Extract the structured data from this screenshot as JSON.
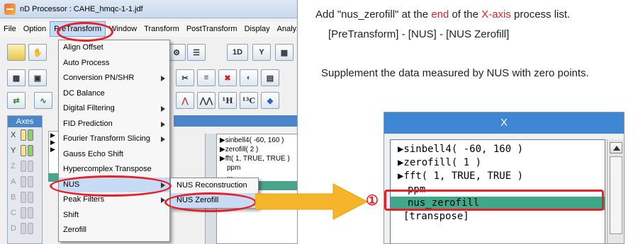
{
  "window": {
    "title": "nD Processor : CAHE_hmqc-1-1.jdf"
  },
  "menubar": [
    "File",
    "Option",
    "PreTransform",
    "Window",
    "Transform",
    "PostTransform",
    "Display",
    "Analyz"
  ],
  "toolbar": {
    "btn_1d": "1D",
    "btn_y": "Y",
    "btn_1h": "¹H",
    "btn_13c": "¹³C",
    "btn_spectrum": "⋀⋀"
  },
  "axes_panel": {
    "title": "Axes",
    "rows": [
      "X",
      "Y",
      "Z",
      "A",
      "B",
      "C",
      "D"
    ]
  },
  "pretransform_menu": {
    "items": [
      {
        "label": "Align Offset",
        "submenu": false
      },
      {
        "label": "Auto Process",
        "submenu": false
      },
      {
        "label": "Conversion PN/SHR",
        "submenu": true
      },
      {
        "label": "DC Balance",
        "submenu": false
      },
      {
        "label": "Digital Filtering",
        "submenu": true
      },
      {
        "label": "FID Prediction",
        "submenu": true
      },
      {
        "label": "Fourier Transform Slicing",
        "submenu": true
      },
      {
        "label": "Gauss Echo Shift",
        "submenu": false
      },
      {
        "label": "Hypercomplex Transpose",
        "submenu": false
      },
      {
        "label": "NUS",
        "submenu": true
      },
      {
        "label": "Peak Filters",
        "submenu": true
      },
      {
        "label": "Shift",
        "submenu": false
      },
      {
        "label": "Zerofill",
        "submenu": false
      }
    ]
  },
  "nus_submenu": {
    "items": [
      "NUS Reconstruction",
      "NUS Zerofill"
    ]
  },
  "process_list_small": [
    "▶sinbell4( -60, 160 )",
    "▶zerofill( 2 )",
    "▶fft( 1, TRUE, TRUE )",
    "ppm",
    "...",
    "se]"
  ],
  "instructions": {
    "line1_a": "Add \"nus_zerofill\" at the ",
    "line1_b": "end",
    "line1_c": " of the ",
    "line1_d": "X-axis",
    "line1_e": " process list.",
    "line2": "[PreTransform] - [NUS] - [NUS Zerofill]",
    "line3": "Supplement the data measured by NUS with zero points."
  },
  "zoom_panel": {
    "header": "X",
    "rows": [
      "▶sinbell4( -60, 160 )",
      "▶zerofill( 1 )",
      "▶fft( 1, TRUE, TRUE )",
      "ppm",
      "nus_zerofill",
      "[transpose]"
    ],
    "step_marker": "①"
  },
  "colors": {
    "accent_red": "#e8202a",
    "highlight_green": "#3ea888",
    "header_blue": "#3f86d4",
    "arrow_orange": "#f5b52a"
  }
}
